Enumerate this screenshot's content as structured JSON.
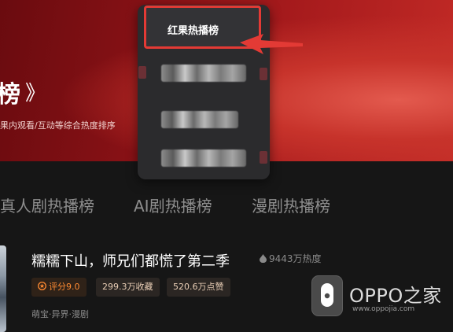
{
  "hero": {
    "title": "榜",
    "decoration": "》",
    "subtitle": "果内观看/互动等综合热度排序"
  },
  "dropdown": {
    "selected_label": "红果热播榜",
    "blurred_options": 3
  },
  "tabs": [
    {
      "label": "真人剧热播榜"
    },
    {
      "label": "AI剧热播榜"
    },
    {
      "label": "漫剧热播榜"
    }
  ],
  "show": {
    "title": "糯糯下山，师兄们都慌了第二季",
    "heat": "9443万热度",
    "tags": {
      "score": "评分9.0",
      "favorites": "299.3万收藏",
      "likes": "520.6万点赞"
    },
    "genres": "萌宝·异界·漫剧"
  },
  "watermark": {
    "name": "OPPO之家",
    "url": "www.oppojia.com"
  },
  "colors": {
    "accent_red": "#e33a35",
    "tag_orange": "#ff8b32"
  }
}
